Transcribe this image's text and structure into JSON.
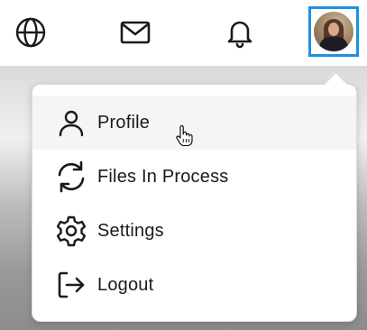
{
  "header": {
    "icons": {
      "globe": "globe-icon",
      "mail": "mail-icon",
      "bell": "bell-icon"
    },
    "avatar_border_color": "#1e90e0"
  },
  "menu": {
    "items": [
      {
        "label": "Profile",
        "icon": "user-icon"
      },
      {
        "label": "Files In Process",
        "icon": "refresh-icon"
      },
      {
        "label": "Settings",
        "icon": "gear-icon"
      },
      {
        "label": "Logout",
        "icon": "logout-icon"
      }
    ],
    "hovered_index": 0
  }
}
